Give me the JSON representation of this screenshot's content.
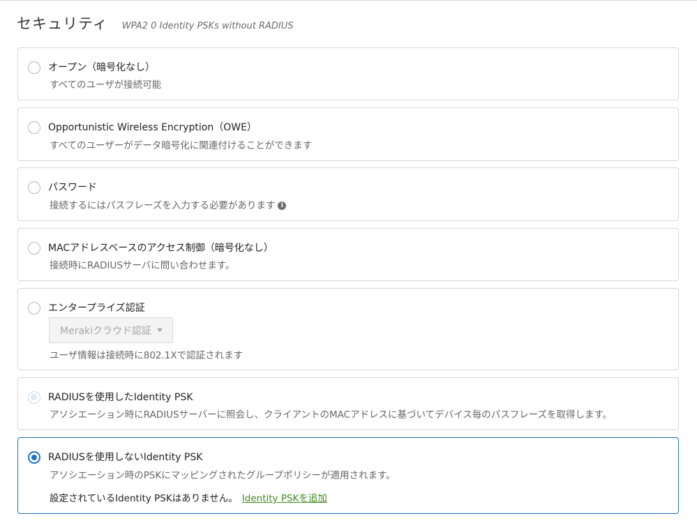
{
  "header": {
    "title": "セキュリティ",
    "subtitle": "WPA2 0 Identity PSKs without RADIUS"
  },
  "options": [
    {
      "label": "オープン（暗号化なし）",
      "description": "すべてのユーザが接続可能",
      "selected": false
    },
    {
      "label": "Opportunistic Wireless Encryption（OWE）",
      "description": "すべてのユーザーがデータ暗号化に関連付けることができます",
      "selected": false
    },
    {
      "label": "パスワード",
      "description": "接続するにはパスフレーズを入力する必要があります",
      "info_icon": "info-icon",
      "selected": false
    },
    {
      "label": "MACアドレスベースのアクセス制御（暗号化なし）",
      "description": "接続時にRADIUSサーバに問い合わせます。",
      "selected": false
    },
    {
      "label": "エンタープライズ認証",
      "dropdown_value": "Merakiクラウド認証",
      "description": "ユーザ情報は接続時に802.1Xで認証されます",
      "selected": false
    },
    {
      "label": "RADIUSを使用したIdentity PSK",
      "description": "アソシエーション時にRADIUSサーバーに照会し、クライアントのMACアドレスに基づいてデバイス毎のパスフレーズを取得します。",
      "selected": false,
      "disabled_look": true
    },
    {
      "label": "RADIUSを使用しないIdentity PSK",
      "description": "アソシエーション時のPSKにマッピングされたグループポリシーが適用されます。",
      "selected": true,
      "empty_text": "設定されているIdentity PSKはありません。",
      "add_link": "Identity PSKを追加"
    }
  ],
  "colors": {
    "accent": "#1a73c7",
    "link": "#3f8d1c",
    "border": "#d6d6d6"
  }
}
